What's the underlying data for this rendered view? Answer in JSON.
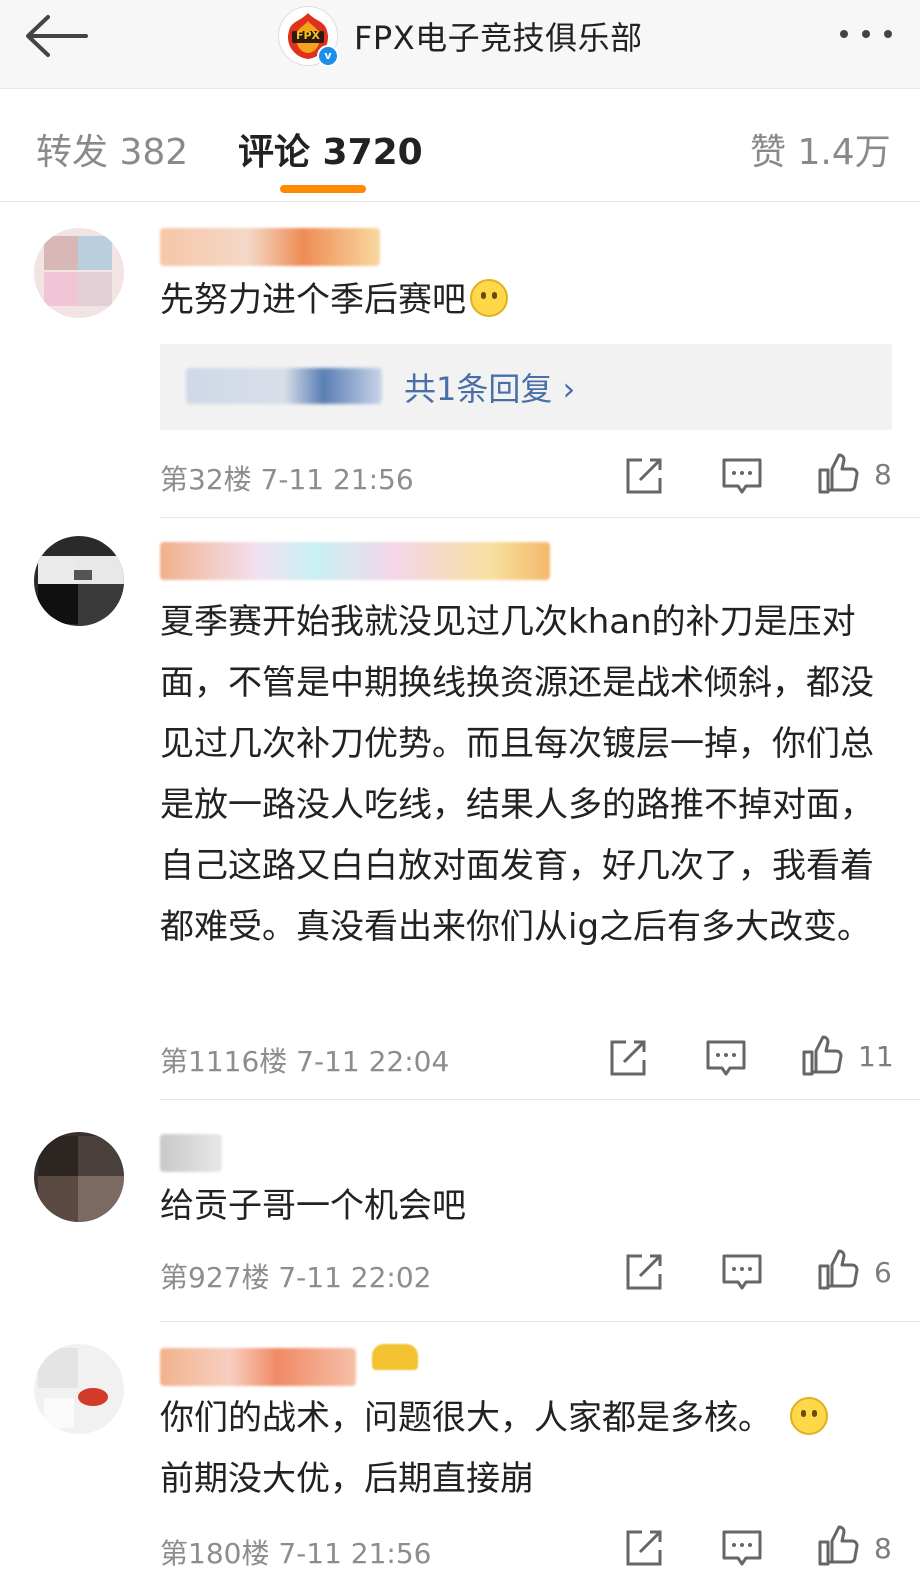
{
  "header": {
    "title": "FPX电子竞技俱乐部",
    "logo_text": "FPX",
    "verified_mark": "v",
    "icons": [
      "back-arrow-icon",
      "more-icon"
    ]
  },
  "tabs": {
    "repost": "转发 382",
    "comments": "评论 3720",
    "likes": "赞 1.4万",
    "active_color": "#ff8a00"
  },
  "comments": [
    {
      "text": "先努力进个季后赛吧",
      "emoji": "frown-emoji",
      "reply_link": "共1条回复 ›",
      "meta": "第32楼 7-11 21:56",
      "likes": "8"
    },
    {
      "text": "夏季赛开始我就没见过几次khan的补刀是压对面，不管是中期换线换资源还是战术倾斜，都没见过几次补刀优势。而且每次镀层一掉，你们总是放一路没人吃线，结果人多的路推不掉对面，自己这路又白白放对面发育，好几次了，我看着都难受。真没看出来你们从ig之后有多大改变。",
      "meta": "第1116楼 7-11 22:04",
      "likes": "11"
    },
    {
      "text": "给贡子哥一个机会吧",
      "meta": "第927楼 7-11 22:02",
      "likes": "6"
    },
    {
      "text": "你们的战术，问题很大，人家都是多核。",
      "emoji": "shush-emoji",
      "text2": "前期没大优，后期直接崩",
      "meta": "第180楼 7-11 21:56",
      "likes": "8"
    }
  ],
  "action_icons": [
    "repost-icon",
    "comment-icon",
    "like-icon"
  ]
}
